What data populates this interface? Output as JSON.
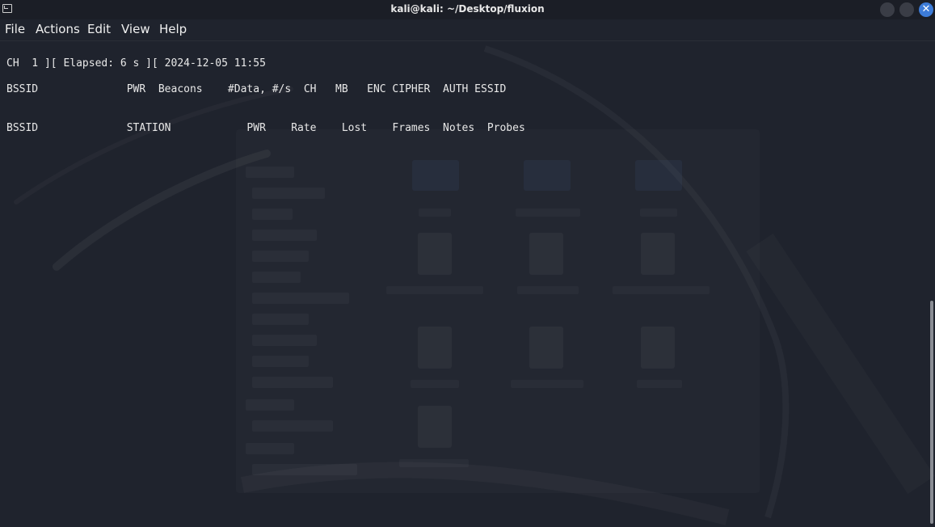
{
  "window": {
    "title": "kali@kali: ~/Desktop/fluxion",
    "close_glyph": "✕"
  },
  "menu": {
    "items": [
      "File",
      "Actions",
      "Edit",
      "View",
      "Help"
    ]
  },
  "terminal": {
    "lines": [
      "CH  1 ][ Elapsed: 6 s ][ 2024-12-05 11:55",
      "BSSID              PWR  Beacons    #Data, #/s  CH   MB   ENC CIPHER  AUTH ESSID",
      "BSSID              STATION            PWR    Rate    Lost    Frames  Notes  Probes"
    ]
  },
  "colors": {
    "background": "#1f232d",
    "titlebar": "#1b1e26",
    "close_button": "#3d7cd8",
    "text": "#e8e8e8"
  },
  "icons": {
    "window_icon": "terminal-icon",
    "minimize": "minimize-icon",
    "maximize": "maximize-icon",
    "close": "close-icon"
  }
}
